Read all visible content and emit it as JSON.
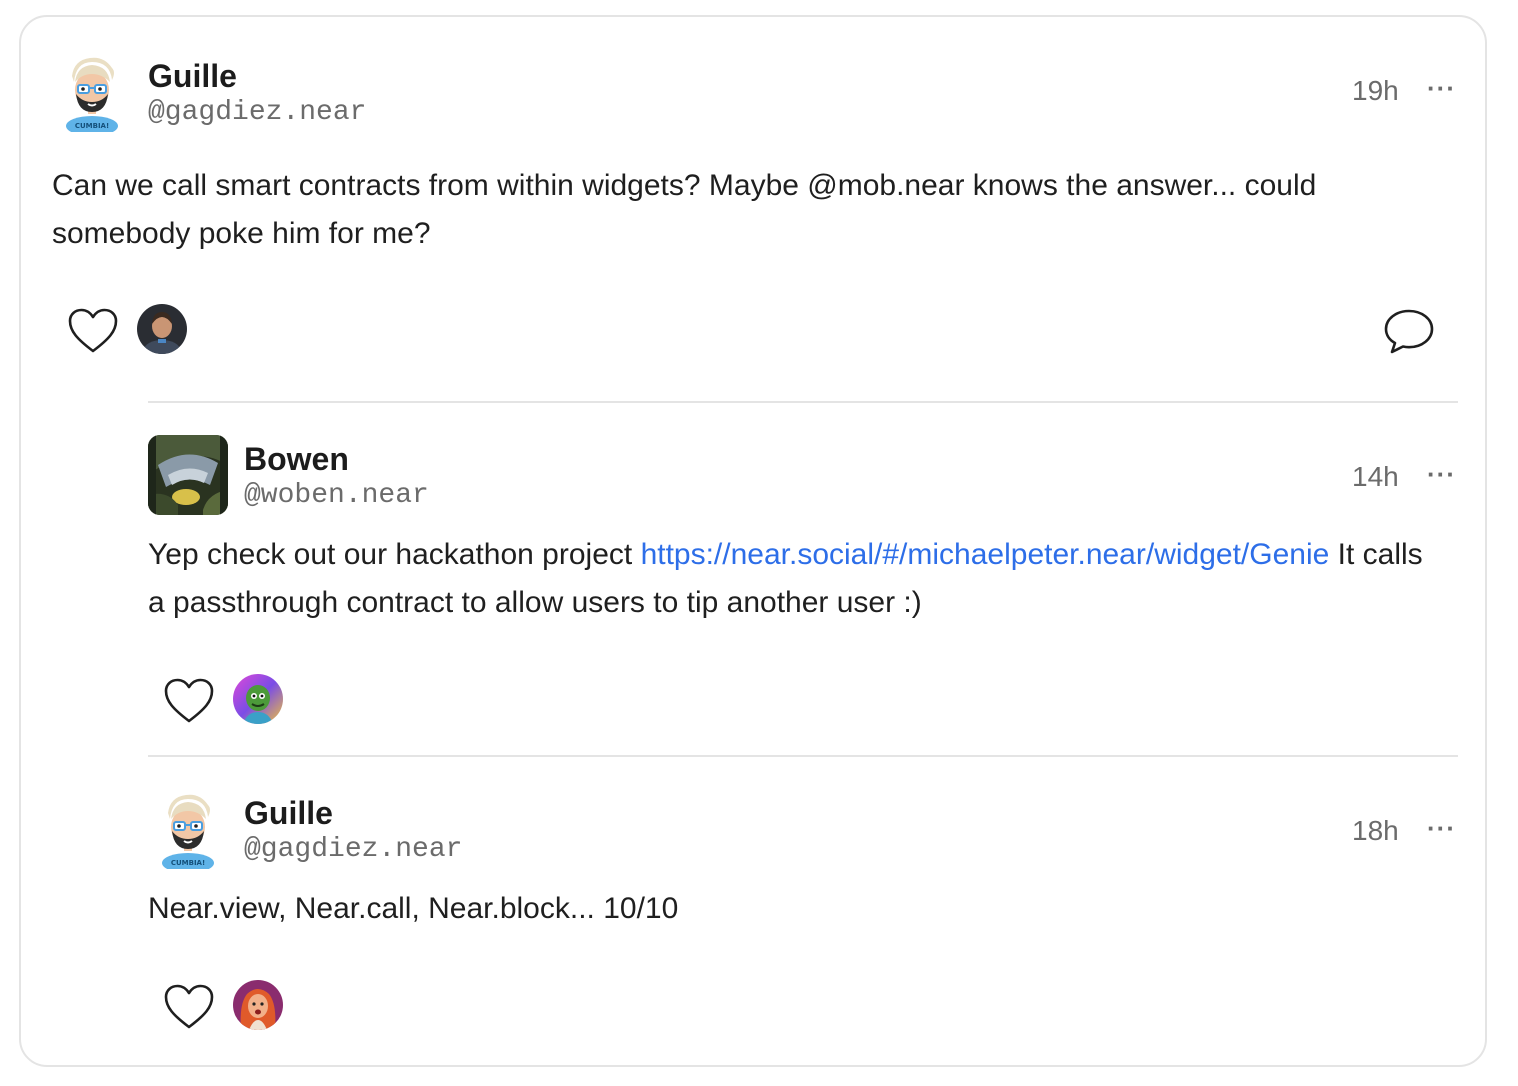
{
  "posts": [
    {
      "author": {
        "name": "Guille",
        "handle": "@gagdiez.near"
      },
      "time": "19h",
      "more": "···",
      "text": "Can we call smart contracts from within widgets? Maybe @mob.near knows the answer... could somebody poke him for me?"
    },
    {
      "author": {
        "name": "Bowen",
        "handle": "@woben.near"
      },
      "time": "14h",
      "more": "···",
      "text_before": "Yep check out our hackathon project ",
      "link": "https://near.social/#/michaelpeter.near/widget/Genie",
      "text_after": " It calls a passthrough contract to allow users to tip another user :)"
    },
    {
      "author": {
        "name": "Guille",
        "handle": "@gagdiez.near"
      },
      "time": "18h",
      "more": "···",
      "text": "Near.view, Near.call, Near.block... 10/10"
    }
  ],
  "icons": {
    "like": "heart-icon",
    "comment": "comment-icon",
    "more": "more-icon"
  },
  "colors": {
    "link": "#2d6ee8",
    "border": "#e4e4e4",
    "muted": "#6b6b6b"
  }
}
